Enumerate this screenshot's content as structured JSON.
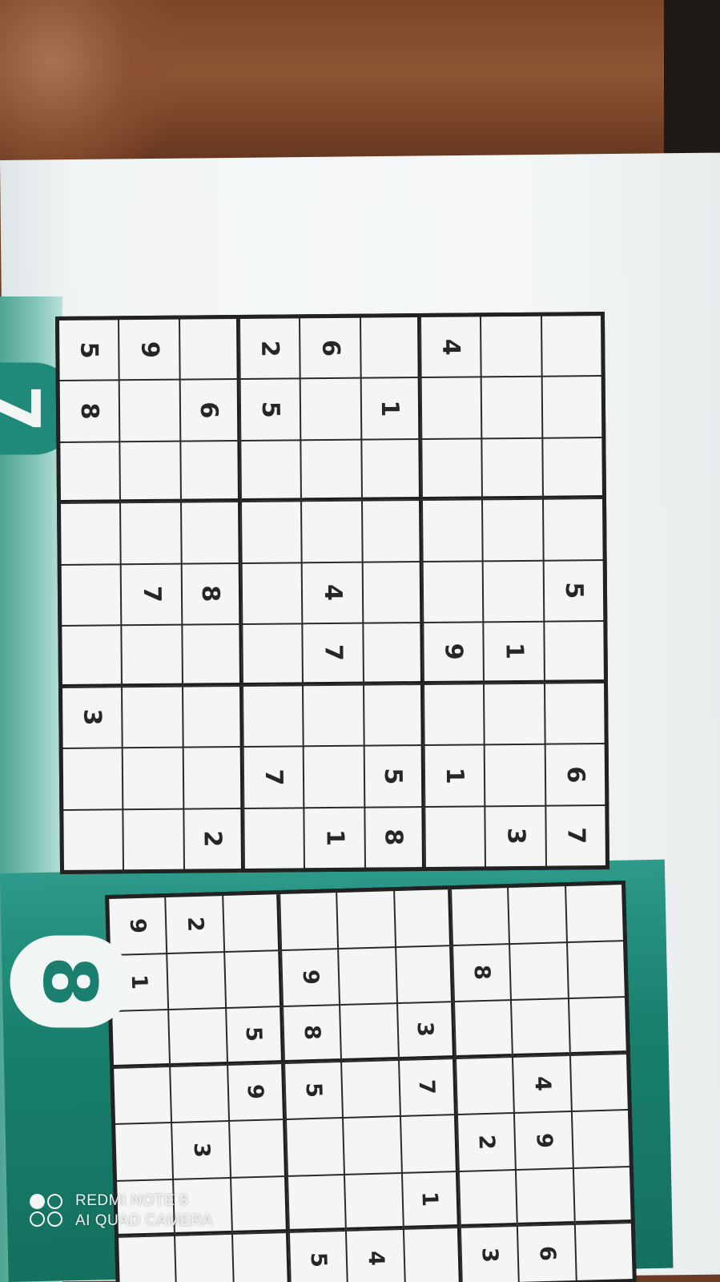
{
  "puzzle_7": {
    "number": "7",
    "cells": [
      [
        "",
        "",
        "3",
        "",
        "",
        "",
        "",
        "8",
        "5"
      ],
      [
        "",
        "",
        "",
        "",
        "7",
        "",
        "",
        "",
        "9"
      ],
      [
        "2",
        "",
        "",
        "",
        "8",
        "",
        "",
        "6",
        ""
      ],
      [
        "",
        "7",
        "",
        "",
        "",
        "",
        "",
        "5",
        "2"
      ],
      [
        "1",
        "",
        "",
        "7",
        "4",
        "",
        "",
        "",
        "6"
      ],
      [
        "8",
        "5",
        "",
        "",
        "",
        "",
        "",
        "1",
        ""
      ],
      [
        "",
        "1",
        "",
        "9",
        "",
        "",
        "",
        "",
        "4"
      ],
      [
        "3",
        "",
        "",
        "1",
        "",
        "",
        "",
        "",
        ""
      ],
      [
        "7",
        "6",
        "",
        "",
        "5",
        "",
        "",
        "",
        ""
      ]
    ]
  },
  "puzzle_8": {
    "number": "8",
    "cells": [
      [
        "",
        "",
        "",
        "",
        "",
        "1",
        "9",
        "",
        ""
      ],
      [
        "",
        "",
        "3",
        "",
        "",
        "",
        "2",
        "",
        ""
      ],
      [
        "",
        "",
        "",
        "9",
        "5",
        "",
        "",
        "",
        ""
      ],
      [
        "5",
        "",
        "",
        "5",
        "8",
        "9",
        "",
        "",
        ""
      ],
      [
        "4",
        "",
        "",
        "",
        "",
        "",
        "",
        "",
        ""
      ],
      [
        "",
        "1",
        "",
        "7",
        "3",
        "",
        "",
        "",
        ""
      ],
      [
        "3",
        "",
        "2",
        "",
        "",
        "8",
        "",
        "",
        ""
      ],
      [
        "6",
        "",
        "9",
        "4",
        "",
        "",
        "",
        "",
        ""
      ]
    ]
  },
  "watermark": {
    "line1": "REDMI NOTE 8",
    "line2": "AI QUAD CAMERA"
  }
}
